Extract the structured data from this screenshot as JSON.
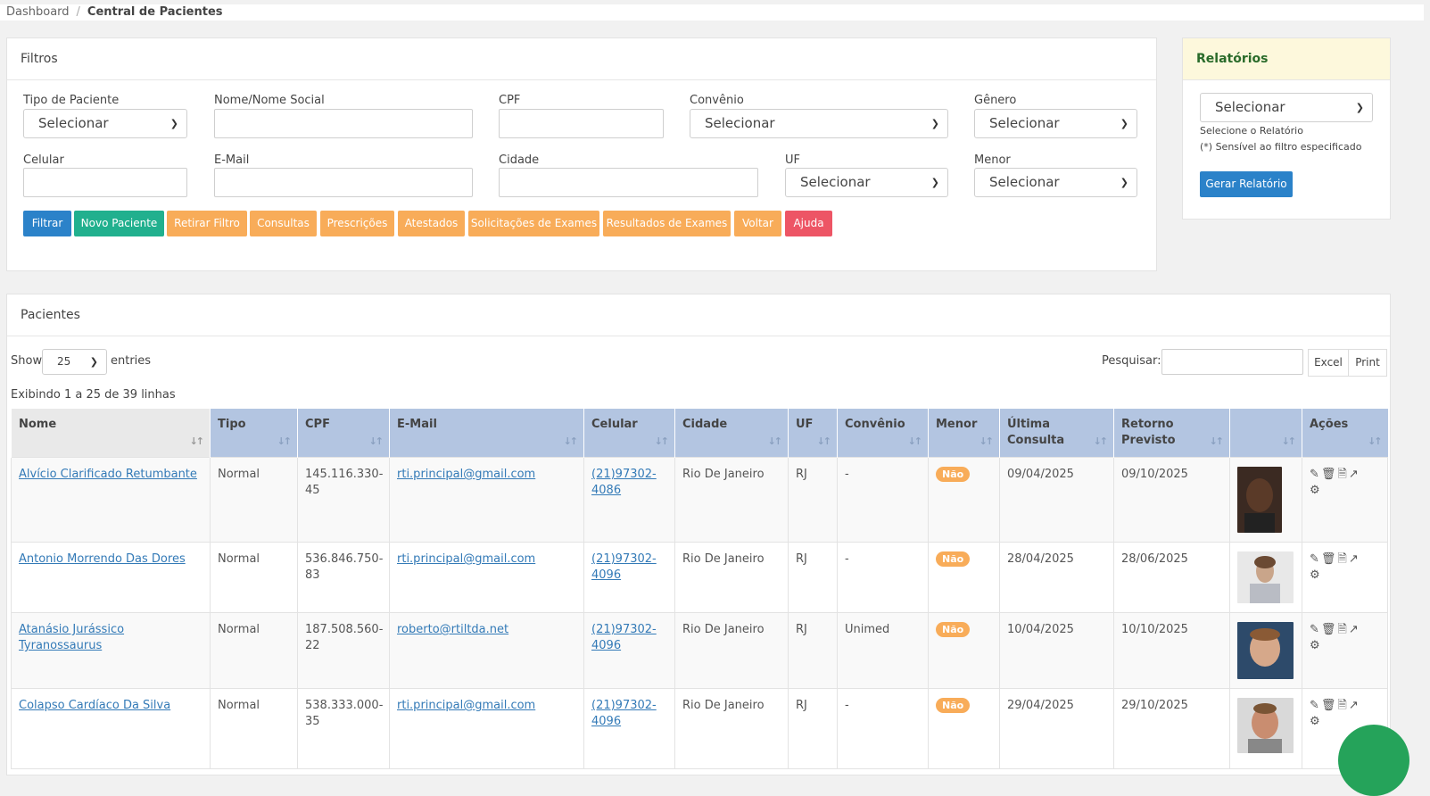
{
  "breadcrumb": {
    "root": "Dashboard",
    "current": "Central de Pacientes"
  },
  "filters": {
    "title": "Filtros",
    "labels": {
      "tipo": "Tipo de Paciente",
      "nome": "Nome/Nome Social",
      "cpf": "CPF",
      "convenio": "Convênio",
      "genero": "Gênero",
      "celular": "Celular",
      "email": "E-Mail",
      "cidade": "Cidade",
      "uf": "UF",
      "menor": "Menor"
    },
    "select_value": "Selecionar",
    "buttons": {
      "filtrar": "Filtrar",
      "novo": "Novo Paciente",
      "retirar": "Retirar Filtro",
      "consultas": "Consultas",
      "prescricoes": "Prescrições",
      "atestados": "Atestados",
      "solicitacoes": "Solicitações de Exames",
      "resultados": "Resultados de Exames",
      "voltar": "Voltar",
      "ajuda": "Ajuda"
    }
  },
  "reports": {
    "title": "Relatórios",
    "select_value": "Selecionar",
    "hint1": "Selecione o Relatório",
    "hint2": "(*) Sensível ao filtro especificado",
    "button": "Gerar Relatório"
  },
  "patients": {
    "title": "Pacientes",
    "show_label": "Show",
    "entries_value": "25",
    "entries_label": "entries",
    "search_label": "Pesquisar:",
    "excel": "Excel",
    "print": "Print",
    "info": "Exibindo 1 a 25 de 39 linhas",
    "headers": {
      "nome": "Nome",
      "tipo": "Tipo",
      "cpf": "CPF",
      "email": "E-Mail",
      "celular": "Celular",
      "cidade": "Cidade",
      "uf": "UF",
      "convenio": "Convênio",
      "menor": "Menor",
      "ultima1": "Última",
      "ultima2": "Consulta",
      "retorno1": "Retorno",
      "retorno2": "Previsto",
      "acoes": "Ações"
    },
    "rows": [
      {
        "nome": "Alvício Clarificado Retumbante",
        "tipo": "Normal",
        "cpf1": "145.116.330-",
        "cpf2": "45",
        "email": "rti.principal@gmail.com",
        "cel1": "(21)97302-",
        "cel2": "4086",
        "cidade": "Rio De Janeiro",
        "uf": "RJ",
        "convenio": "-",
        "menor": "Não",
        "ultima": "09/04/2025",
        "retorno": "09/10/2025"
      },
      {
        "nome": "Antonio Morrendo Das Dores",
        "tipo": "Normal",
        "cpf1": "536.846.750-",
        "cpf2": "83",
        "email": "rti.principal@gmail.com",
        "cel1": "(21)97302-",
        "cel2": "4096",
        "cidade": "Rio De Janeiro",
        "uf": "RJ",
        "convenio": "-",
        "menor": "Não",
        "ultima": "28/04/2025",
        "retorno": "28/06/2025"
      },
      {
        "nome": "Atanásio Jurássico Tyranossaurus",
        "tipo": "Normal",
        "cpf1": "187.508.560-",
        "cpf2": "22",
        "email": "roberto@rtiltda.net",
        "cel1": "(21)97302-",
        "cel2": "4096",
        "cidade": "Rio De Janeiro",
        "uf": "RJ",
        "convenio": "Unimed",
        "menor": "Não",
        "ultima": "10/04/2025",
        "retorno": "10/10/2025"
      },
      {
        "nome": "Colapso Cardíaco Da Silva",
        "tipo": "Normal",
        "cpf1": "538.333.000-",
        "cpf2": "35",
        "email": "rti.principal@gmail.com",
        "cel1": "(21)97302-",
        "cel2": "4096",
        "cidade": "Rio De Janeiro",
        "uf": "RJ",
        "convenio": "-",
        "menor": "Não",
        "ultima": "29/04/2025",
        "retorno": "29/10/2025"
      }
    ]
  },
  "colors": {
    "primary": "#2b82c9",
    "success": "#21b08e",
    "warning": "#f8ac59",
    "danger": "#ed5565",
    "table_header": "#b3c5e1"
  }
}
